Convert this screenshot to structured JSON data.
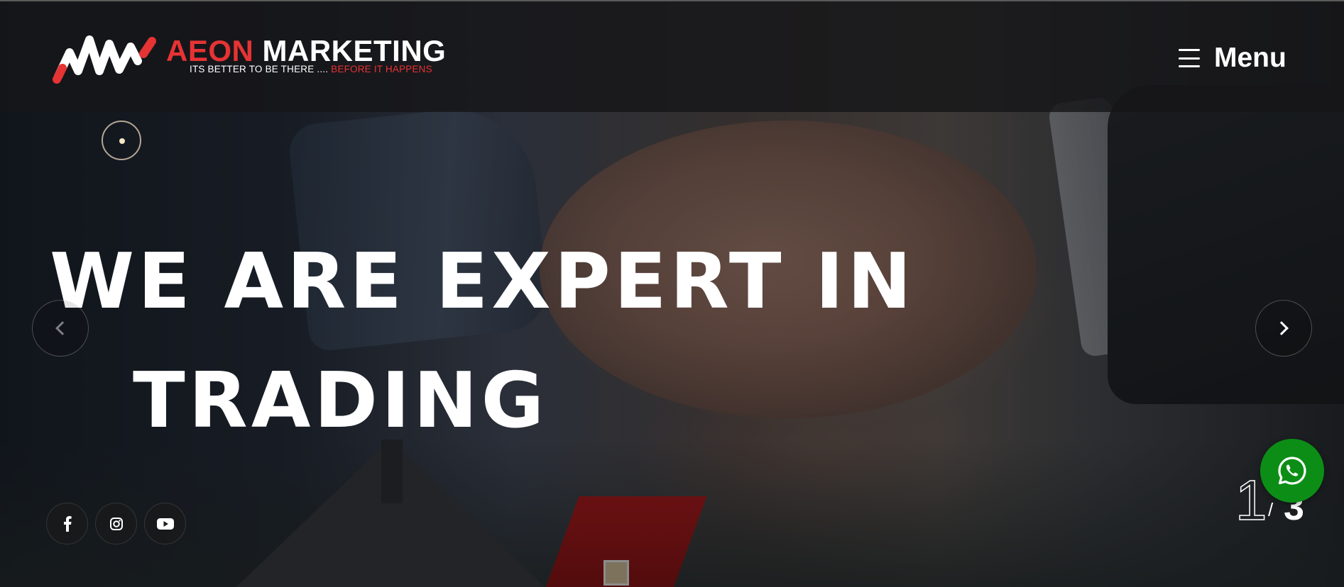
{
  "brand": {
    "name_part1": "AEON",
    "name_part2": "MARKETING",
    "tagline_part1": "ITS BETTER TO BE THERE .... ",
    "tagline_part2": "BEFORE IT HAPPENS",
    "accent_color": "#e63334"
  },
  "nav": {
    "menu_label": "Menu",
    "menu_icon": "hamburger-icon"
  },
  "hero": {
    "headline_line1": "WE ARE EXPERT IN",
    "headline_line2": "TRADING",
    "prev_icon": "chevron-left-icon",
    "next_icon": "chevron-right-icon"
  },
  "social": [
    {
      "name": "facebook-icon",
      "glyph": "f"
    },
    {
      "name": "instagram-icon",
      "glyph": "instagram"
    },
    {
      "name": "youtube-icon",
      "glyph": "youtube"
    }
  ],
  "slider": {
    "current": "1",
    "separator": "/",
    "total": "3"
  },
  "whatsapp": {
    "icon": "whatsapp-icon",
    "color": "#0c8e16"
  }
}
